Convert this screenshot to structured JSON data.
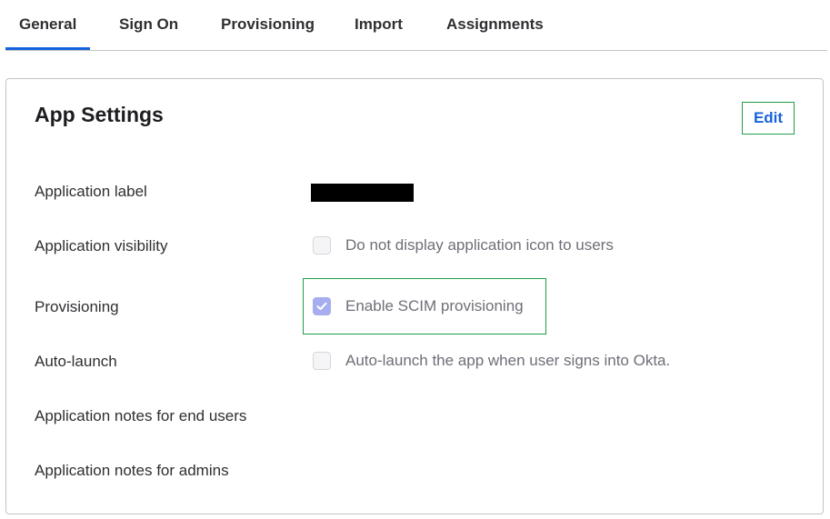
{
  "tabs": [
    {
      "label": "General",
      "active": true
    },
    {
      "label": "Sign On",
      "active": false
    },
    {
      "label": "Provisioning",
      "active": false
    },
    {
      "label": "Import",
      "active": false
    },
    {
      "label": "Assignments",
      "active": false
    }
  ],
  "app_settings": {
    "title": "App Settings",
    "edit_label": "Edit",
    "rows": [
      {
        "label": "Application label",
        "value": "[redacted]"
      },
      {
        "label": "Application visibility",
        "checkbox_label": "Do not display application icon to users",
        "checked": false
      },
      {
        "label": "Provisioning",
        "checkbox_label": "Enable SCIM provisioning",
        "checked": true
      },
      {
        "label": "Auto-launch",
        "checkbox_label": "Auto-launch the app when user signs into Okta.",
        "checked": false
      },
      {
        "label": "Application notes for end users"
      },
      {
        "label": "Application notes for admins"
      }
    ]
  },
  "colors": {
    "accent": "#1662dd",
    "highlight": "#1f9e45",
    "checkbox_checked": "#a7aeef"
  }
}
